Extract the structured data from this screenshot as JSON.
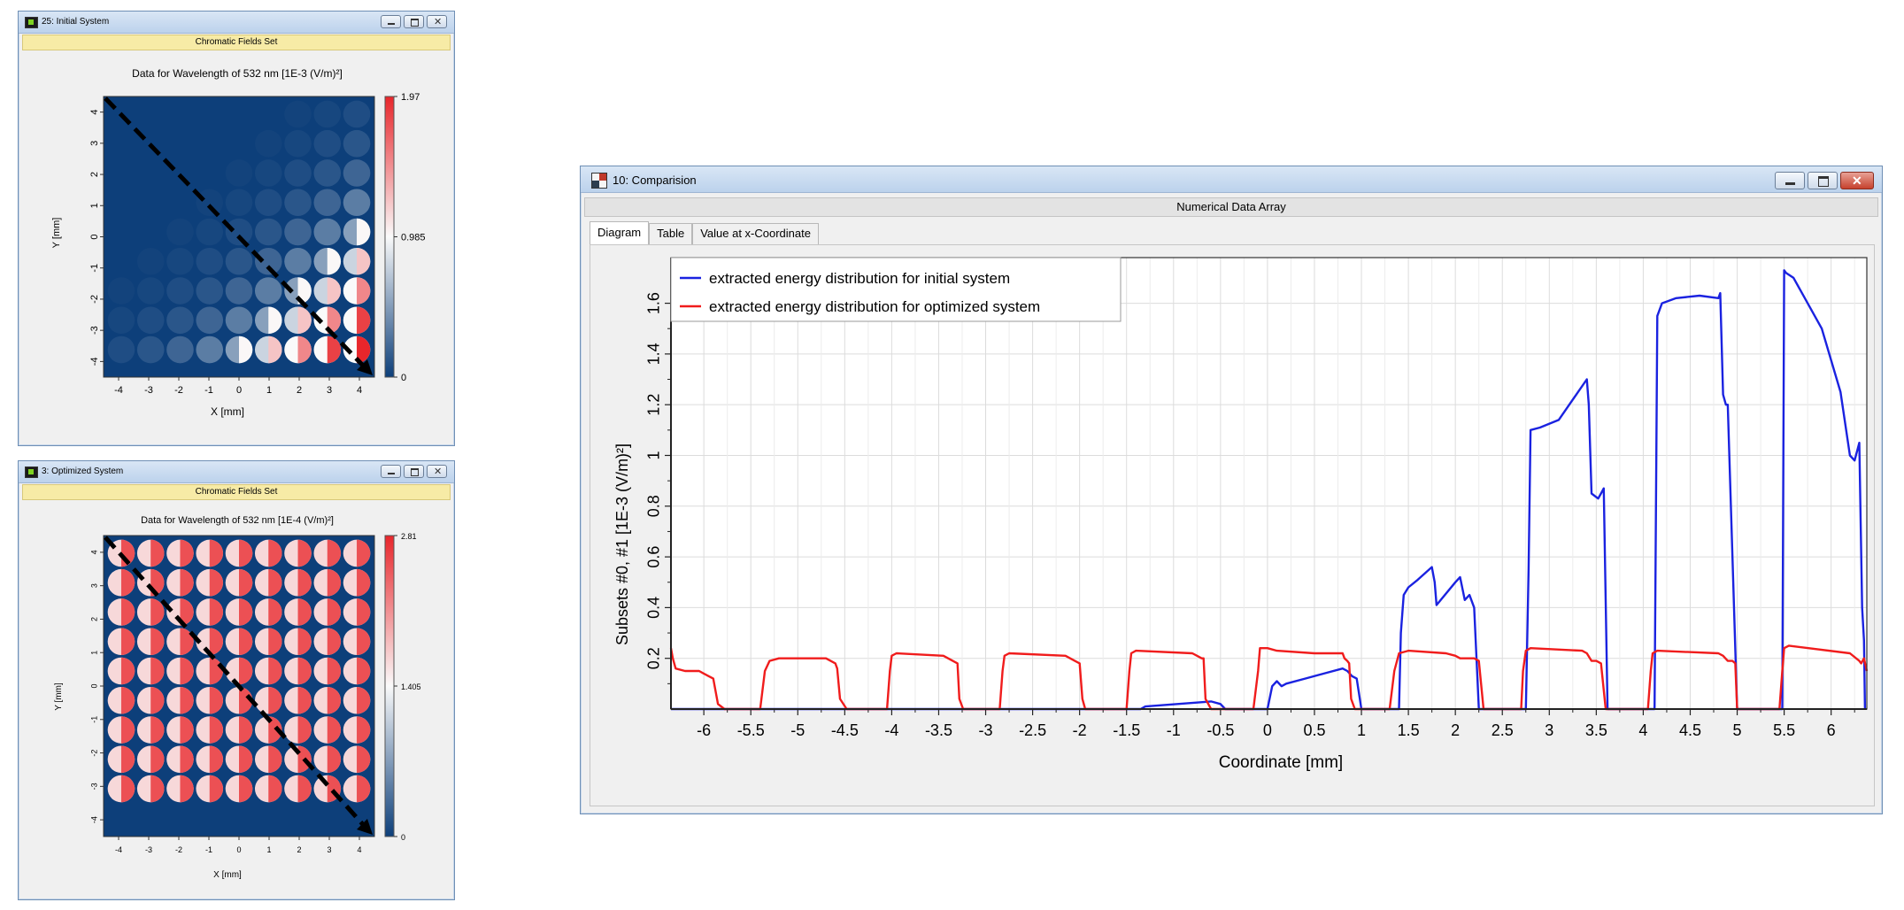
{
  "windows": {
    "initial": {
      "title": "25: Initial System",
      "subheader": "Chromatic Fields Set",
      "plot": {
        "title": "Data for Wavelength of 532 nm  [1E-3 (V/m)²]",
        "xlabel": "X [mm]",
        "ylabel": "Y [mm]",
        "xticks": [
          "-4",
          "-3",
          "-2",
          "-1",
          "0",
          "1",
          "2",
          "3",
          "4"
        ],
        "yticks": [
          "4",
          "3",
          "2",
          "1",
          "0",
          "-1",
          "-2",
          "-3",
          "-4"
        ],
        "colorbar": [
          "1.97",
          "0.985",
          "0"
        ]
      }
    },
    "optimized": {
      "title": "3: Optimized System",
      "subheader": "Chromatic Fields Set",
      "plot": {
        "title": "Data for Wavelength of 532 nm  [1E-4 (V/m)²]",
        "xlabel": "X [mm]",
        "ylabel": "Y [mm]",
        "xticks": [
          "-4",
          "-3",
          "-2",
          "-1",
          "0",
          "1",
          "2",
          "3",
          "4"
        ],
        "yticks": [
          "4",
          "3",
          "2",
          "1",
          "0",
          "-1",
          "-2",
          "-3",
          "-4"
        ],
        "colorbar": [
          "2.81",
          "1.405",
          "0"
        ]
      }
    },
    "comparison": {
      "title": "10: Comparision",
      "subheader": "Numerical Data Array",
      "tabs": [
        "Diagram",
        "Table",
        "Value at x-Coordinate"
      ]
    }
  },
  "colors": {
    "field_low": "#0d3f7a",
    "field_high": "#e8262b",
    "initial_series": "#1a22e0",
    "optimized_series": "#f01c1c"
  },
  "chart_data": {
    "type": "line",
    "xlabel": "Coordinate [mm]",
    "ylabel": "Subsets #0, #1 [1E-3 (V/m)²]",
    "xlim": [
      -6.35,
      6.38
    ],
    "ylim": [
      0,
      1.78
    ],
    "xticks": [
      -6,
      -5.5,
      -5,
      -4.5,
      -4,
      -3.5,
      -3,
      -2.5,
      -2,
      -1.5,
      -1,
      -0.5,
      0,
      0.5,
      1,
      1.5,
      2,
      2.5,
      3,
      3.5,
      4,
      4.5,
      5,
      5.5,
      6
    ],
    "xtick_labels": [
      "-6",
      "-5.5",
      "-5",
      "-4.5",
      "-4",
      "-3.5",
      "-3",
      "-2.5",
      "-2",
      "-1.5",
      "-1",
      "-0.5",
      "0",
      "0.5",
      "1",
      "1.5",
      "2",
      "2.5",
      "3",
      "3.5",
      "4",
      "4.5",
      "5",
      "5.5",
      "6"
    ],
    "yticks": [
      0.2,
      0.4,
      0.6,
      0.8,
      1,
      1.2,
      1.4,
      1.6
    ],
    "ytick_labels": [
      "0.2",
      "0.4",
      "0.6",
      "0.8",
      "1",
      "1.2",
      "1.4",
      "1.6"
    ],
    "grid": true,
    "legend_position": "top-left",
    "series": [
      {
        "name": "extracted energy distribution for initial system",
        "color": "#1a22e0",
        "x": [
          -6.35,
          -1.35,
          -1.3,
          -0.6,
          -0.5,
          -0.45,
          0.0,
          0.05,
          0.1,
          0.15,
          0.2,
          0.4,
          0.6,
          0.8,
          0.85,
          0.9,
          0.95,
          1.0,
          1.4,
          1.42,
          1.45,
          1.5,
          1.6,
          1.75,
          1.78,
          1.8,
          2.0,
          2.05,
          2.1,
          2.15,
          2.2,
          2.25,
          2.75,
          2.78,
          2.8,
          2.9,
          3.1,
          3.4,
          3.42,
          3.45,
          3.52,
          3.55,
          3.58,
          3.62,
          4.12,
          4.15,
          4.2,
          4.35,
          4.6,
          4.8,
          4.82,
          4.85,
          4.88,
          4.9,
          5.0,
          5.48,
          5.5,
          5.52,
          5.6,
          5.9,
          6.1,
          6.2,
          6.25,
          6.3,
          6.33,
          6.35,
          6.36
        ],
        "y": [
          0,
          0,
          0.01,
          0.03,
          0.02,
          0,
          0,
          0.09,
          0.11,
          0.09,
          0.1,
          0.12,
          0.14,
          0.16,
          0.15,
          0.13,
          0.12,
          0,
          0,
          0.3,
          0.45,
          0.48,
          0.51,
          0.56,
          0.5,
          0.41,
          0.5,
          0.52,
          0.43,
          0.45,
          0.4,
          0,
          0,
          0.55,
          1.1,
          1.11,
          1.14,
          1.3,
          1.2,
          0.85,
          0.83,
          0.85,
          0.87,
          0,
          0,
          1.55,
          1.6,
          1.62,
          1.63,
          1.62,
          1.64,
          1.24,
          1.2,
          1.2,
          0,
          0,
          1.73,
          1.72,
          1.7,
          1.5,
          1.25,
          1.0,
          0.98,
          1.05,
          0.4,
          0.27,
          0
        ],
        "points_are_approximate": true
      },
      {
        "name": "extracted energy distribution for optimized system",
        "color": "#f01c1c",
        "x": [
          -6.35,
          -6.33,
          -6.3,
          -6.2,
          -6.05,
          -6.0,
          -5.95,
          -5.9,
          -5.85,
          -5.78,
          -5.4,
          -5.35,
          -5.3,
          -5.2,
          -4.7,
          -4.65,
          -4.6,
          -4.58,
          -4.55,
          -4.48,
          -4.05,
          -4.02,
          -4.0,
          -3.95,
          -3.45,
          -3.4,
          -3.35,
          -3.3,
          -3.28,
          -3.24,
          -2.85,
          -2.82,
          -2.8,
          -2.75,
          -2.15,
          -2.1,
          -2.05,
          -2.0,
          -1.97,
          -1.94,
          -1.5,
          -1.47,
          -1.45,
          -1.4,
          -0.8,
          -0.75,
          -0.7,
          -0.68,
          -0.66,
          -0.6,
          -0.15,
          -0.1,
          -0.08,
          0.0,
          0.1,
          0.5,
          0.8,
          0.82,
          0.85,
          0.87,
          0.89,
          0.93,
          1.3,
          1.35,
          1.4,
          1.5,
          1.9,
          2.0,
          2.05,
          2.2,
          2.25,
          2.3,
          2.7,
          2.72,
          2.75,
          2.8,
          3.35,
          3.4,
          3.45,
          3.5,
          3.55,
          3.6,
          4.05,
          4.08,
          4.1,
          4.15,
          4.8,
          4.85,
          4.9,
          4.95,
          4.98,
          5.0,
          5.45,
          5.48,
          5.5,
          5.55,
          6.2,
          6.3,
          6.32,
          6.35,
          6.38
        ],
        "y": [
          0.24,
          0.2,
          0.16,
          0.15,
          0.15,
          0.14,
          0.13,
          0.12,
          0.02,
          0,
          0,
          0.15,
          0.19,
          0.2,
          0.2,
          0.19,
          0.18,
          0.16,
          0.04,
          0,
          0,
          0.15,
          0.21,
          0.22,
          0.21,
          0.2,
          0.19,
          0.18,
          0.04,
          0,
          0,
          0.15,
          0.21,
          0.22,
          0.21,
          0.2,
          0.19,
          0.18,
          0.04,
          0,
          0,
          0.15,
          0.22,
          0.23,
          0.22,
          0.21,
          0.2,
          0.2,
          0.04,
          0,
          0,
          0.15,
          0.24,
          0.24,
          0.23,
          0.22,
          0.22,
          0.2,
          0.19,
          0.18,
          0.04,
          0,
          0,
          0.15,
          0.22,
          0.23,
          0.22,
          0.21,
          0.2,
          0.2,
          0.19,
          0,
          0,
          0.15,
          0.23,
          0.24,
          0.23,
          0.22,
          0.19,
          0.19,
          0.18,
          0,
          0,
          0.15,
          0.22,
          0.23,
          0.22,
          0.21,
          0.19,
          0.19,
          0.18,
          0,
          0,
          0.15,
          0.24,
          0.25,
          0.22,
          0.19,
          0.18,
          0.2,
          0.15
        ],
        "points_are_approximate": true
      }
    ]
  }
}
